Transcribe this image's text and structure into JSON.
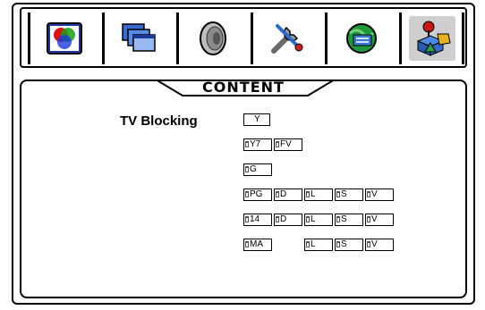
{
  "tabs": [
    {
      "icon": "color-settings-icon",
      "selected": false
    },
    {
      "icon": "windows-display-icon",
      "selected": false
    },
    {
      "icon": "speaker-sound-icon",
      "selected": false
    },
    {
      "icon": "tools-setup-icon",
      "selected": false
    },
    {
      "icon": "globe-network-icon",
      "selected": false
    },
    {
      "icon": "parental-lock-content-icon",
      "selected": true
    }
  ],
  "section_title": "CONTENT",
  "tv_blocking_label": "TV Blocking",
  "rows": [
    {
      "cells": [
        "Y"
      ]
    },
    {
      "cells": [
        "Y7",
        "FV"
      ]
    },
    {
      "cells": [
        "G"
      ]
    },
    {
      "cells": [
        "PG",
        "D",
        "L",
        "S",
        "V"
      ]
    },
    {
      "cells": [
        "14",
        "D",
        "L",
        "S",
        "V"
      ]
    },
    {
      "cells": [
        "MA",
        "L",
        "S",
        "V"
      ]
    }
  ]
}
